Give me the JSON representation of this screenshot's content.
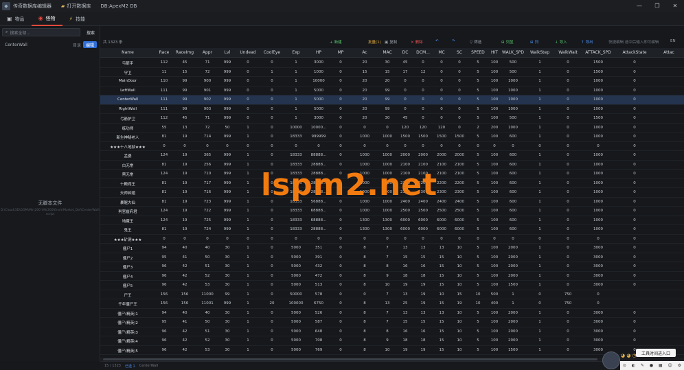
{
  "titlebar": {
    "app": "传奇数据库编辑器",
    "open_db": "打开数据库",
    "db_name": "DB:ApexM2 DB",
    "buttons": [
      "—",
      "❐",
      "✕"
    ]
  },
  "tabs": [
    {
      "icon": "▣",
      "label": "物品"
    },
    {
      "icon": "◉",
      "label": "怪物"
    },
    {
      "icon": "⚡",
      "label": "技能"
    }
  ],
  "sidebar": {
    "search_placeholder": "搜索全部...",
    "search_btn": "搜索",
    "item": "CenterWall",
    "item_extra": "目录",
    "item_btn": "编辑",
    "empty_title": "无脚本文件",
    "empty_sub": "D:\\Cloud\\3D\\GOM\\Mir\\200 \\Mir200\\Envir\\Market_Def\\CenterWall\\ script"
  },
  "toolbar": {
    "count": "共 1323 条",
    "actions": [
      {
        "icon": "+",
        "label": "新建",
        "color": "#57c26a"
      },
      {
        "icon": "",
        "label": "批量(1)",
        "color": "#e0a83a"
      },
      {
        "icon": "▣",
        "label": "复制",
        "color": "#9aa0a8"
      },
      {
        "icon": "✕",
        "label": "删除",
        "color": "#e05050"
      },
      {
        "icon": "↶",
        "label": "",
        "color": "#4c8ef0"
      },
      {
        "icon": "↷",
        "label": "",
        "color": "#4c8ef0"
      },
      {
        "icon": "▽",
        "label": "筛选",
        "color": "#9aa0a8"
      },
      {
        "icon": "⊞",
        "label": "列显",
        "color": "#57c26a"
      },
      {
        "icon": "⊞",
        "label": "列",
        "color": "#4c8ef0"
      },
      {
        "icon": "↓",
        "label": "导入",
        "color": "#57c26a"
      },
      {
        "icon": "↑",
        "label": "导出",
        "color": "#4c8ef0"
      },
      {
        "icon": "",
        "label": "快捷编辑   选中后输入即可编辑",
        "color": "#6f757d"
      },
      {
        "icon": "",
        "label": "EN",
        "color": "#9aa0a8"
      }
    ]
  },
  "columns": [
    "Name",
    "Race",
    "RaceImg",
    "Appr",
    "Lvl",
    "Undead",
    "CoolEye",
    "Exp",
    "HP",
    "MP",
    "Ac",
    "MAC",
    "DC",
    "DCM...",
    "MC",
    "SC",
    "SPEED",
    "HIT",
    "WALK_SPD",
    "WalkStep",
    "WalkWait",
    "ATTACK_SPD",
    "AttackState",
    "Attac"
  ],
  "rows": [
    [
      "弓箭手",
      "112",
      "45",
      "71",
      "999",
      "0",
      "0",
      "1",
      "3000",
      "0",
      "20",
      "30",
      "45",
      "0",
      "0",
      "0",
      "5",
      "100",
      "500",
      "1",
      "0",
      "1500",
      "0"
    ],
    [
      "守卫",
      "11",
      "15",
      "72",
      "999",
      "0",
      "1",
      "1",
      "1000",
      "0",
      "15",
      "15",
      "17",
      "12",
      "0",
      "0",
      "5",
      "100",
      "500",
      "1",
      "0",
      "1500",
      "0"
    ],
    [
      "MainDoor",
      "110",
      "99",
      "900",
      "999",
      "0",
      "0",
      "1",
      "10000",
      "0",
      "20",
      "20",
      "0",
      "0",
      "0",
      "0",
      "5",
      "100",
      "1000",
      "1",
      "0",
      "1000",
      "0"
    ],
    [
      "LeftWall",
      "111",
      "99",
      "901",
      "999",
      "0",
      "0",
      "1",
      "5000",
      "0",
      "20",
      "99",
      "0",
      "0",
      "0",
      "0",
      "5",
      "100",
      "1000",
      "1",
      "0",
      "1000",
      "0"
    ],
    [
      "CenterWall",
      "111",
      "99",
      "902",
      "999",
      "0",
      "0",
      "1",
      "5000",
      "0",
      "20",
      "99",
      "0",
      "0",
      "0",
      "0",
      "5",
      "100",
      "1000",
      "1",
      "0",
      "1000",
      "0"
    ],
    [
      "RightWall",
      "111",
      "99",
      "903",
      "999",
      "0",
      "0",
      "1",
      "5000",
      "0",
      "20",
      "99",
      "0",
      "0",
      "0",
      "0",
      "5",
      "100",
      "1000",
      "1",
      "0",
      "1000",
      "0"
    ],
    [
      "弓箭护卫",
      "112",
      "45",
      "71",
      "999",
      "0",
      "0",
      "1",
      "3000",
      "0",
      "20",
      "30",
      "45",
      "0",
      "0",
      "0",
      "5",
      "100",
      "500",
      "1",
      "0",
      "1500",
      "0"
    ],
    [
      "练功师",
      "55",
      "13",
      "72",
      "50",
      "1",
      "0",
      "10000",
      "10000...",
      "0",
      "0",
      "0",
      "120",
      "120",
      "120",
      "0",
      "2",
      "200",
      "1000",
      "1",
      "0",
      "1000",
      "0"
    ],
    [
      "新生神秘老人",
      "81",
      "19",
      "714",
      "999",
      "1",
      "0",
      "18333",
      "999999",
      "0",
      "1000",
      "1000",
      "1500",
      "1500",
      "1500",
      "1500",
      "5",
      "100",
      "600",
      "1",
      "0",
      "1000",
      "0"
    ],
    [
      "★★★十八地狱★★★",
      "0",
      "0",
      "0",
      "0",
      "0",
      "0",
      "0",
      "0",
      "0",
      "0",
      "0",
      "0",
      "0",
      "0",
      "0",
      "0",
      "0",
      "0",
      "0",
      "0",
      "0",
      "0"
    ],
    [
      "孟婆",
      "124",
      "19",
      "365",
      "999",
      "1",
      "0",
      "18333",
      "88888...",
      "0",
      "1000",
      "1000",
      "2000",
      "2000",
      "2000",
      "2000",
      "5",
      "100",
      "600",
      "1",
      "0",
      "1000",
      "0"
    ],
    [
      "白无常",
      "81",
      "19",
      "256",
      "999",
      "1",
      "0",
      "18333",
      "28888...",
      "0",
      "1000",
      "1000",
      "2100",
      "2100",
      "2100",
      "2100",
      "5",
      "100",
      "600",
      "1",
      "0",
      "1000",
      "0"
    ],
    [
      "黑无常",
      "124",
      "19",
      "710",
      "999",
      "1",
      "0",
      "18333",
      "28888...",
      "0",
      "1000",
      "1000",
      "2100",
      "2100",
      "2100",
      "2100",
      "5",
      "100",
      "600",
      "1",
      "0",
      "1000",
      "0"
    ],
    [
      "十殿阎王",
      "81",
      "19",
      "717",
      "999",
      "1",
      "0",
      "18333",
      "28888...",
      "0",
      "1000",
      "1000",
      "2200",
      "2200",
      "2200",
      "2200",
      "5",
      "100",
      "600",
      "1",
      "0",
      "1000",
      "0"
    ],
    [
      "天师钟馗",
      "81",
      "19",
      "716",
      "999",
      "1",
      "0",
      "18333",
      "28888...",
      "0",
      "1000",
      "1000",
      "2300",
      "2300",
      "2300",
      "2300",
      "5",
      "100",
      "600",
      "1",
      "0",
      "1000",
      "0"
    ],
    [
      "暴躯大仙",
      "81",
      "19",
      "723",
      "999",
      "1",
      "0",
      "18333",
      "56888...",
      "0",
      "1000",
      "1000",
      "2400",
      "2400",
      "2400",
      "2400",
      "5",
      "100",
      "600",
      "1",
      "0",
      "1000",
      "0"
    ],
    [
      "判官崔府君",
      "124",
      "19",
      "722",
      "999",
      "1",
      "0",
      "18333",
      "68888...",
      "0",
      "1000",
      "1000",
      "2500",
      "2500",
      "2500",
      "2500",
      "5",
      "100",
      "600",
      "1",
      "0",
      "1000",
      "0"
    ],
    [
      "地藏王",
      "124",
      "19",
      "725",
      "999",
      "1",
      "0",
      "18333",
      "68888...",
      "0",
      "1300",
      "1300",
      "6000",
      "6000",
      "6000",
      "6000",
      "5",
      "100",
      "600",
      "1",
      "0",
      "1000",
      "0"
    ],
    [
      "鬼王",
      "81",
      "19",
      "724",
      "999",
      "1",
      "0",
      "18333",
      "28888...",
      "0",
      "1300",
      "1300",
      "6000",
      "6000",
      "6000",
      "6000",
      "5",
      "100",
      "600",
      "1",
      "0",
      "1000",
      "0"
    ],
    [
      "★★★矿洞★★★",
      "0",
      "0",
      "0",
      "0",
      "0",
      "0",
      "0",
      "0",
      "0",
      "0",
      "0",
      "0",
      "0",
      "0",
      "0",
      "0",
      "0",
      "0",
      "0",
      "0",
      "0",
      "0"
    ],
    [
      "僵尸1",
      "94",
      "40",
      "40",
      "30",
      "1",
      "0",
      "5000",
      "351",
      "0",
      "8",
      "7",
      "13",
      "13",
      "13",
      "10",
      "5",
      "100",
      "2000",
      "1",
      "0",
      "3000",
      "0"
    ],
    [
      "僵尸2",
      "95",
      "41",
      "50",
      "30",
      "1",
      "0",
      "5000",
      "391",
      "0",
      "8",
      "7",
      "15",
      "15",
      "15",
      "10",
      "5",
      "100",
      "2000",
      "1",
      "0",
      "3000",
      "0"
    ],
    [
      "僵尸3",
      "96",
      "42",
      "51",
      "30",
      "1",
      "0",
      "5000",
      "432",
      "0",
      "8",
      "8",
      "16",
      "16",
      "15",
      "10",
      "5",
      "100",
      "2000",
      "1",
      "0",
      "3000",
      "0"
    ],
    [
      "僵尸4",
      "96",
      "42",
      "52",
      "30",
      "1",
      "0",
      "5000",
      "472",
      "0",
      "8",
      "9",
      "18",
      "18",
      "15",
      "10",
      "5",
      "100",
      "2000",
      "1",
      "0",
      "3000",
      "0"
    ],
    [
      "僵尸5",
      "96",
      "42",
      "53",
      "30",
      "1",
      "0",
      "5000",
      "513",
      "0",
      "8",
      "10",
      "19",
      "19",
      "15",
      "10",
      "5",
      "100",
      "1500",
      "1",
      "0",
      "3000",
      "0"
    ],
    [
      "尸王",
      "156",
      "156",
      "11000",
      "99",
      "1",
      "0",
      "50000",
      "578",
      "0",
      "0",
      "7",
      "13",
      "19",
      "10",
      "15",
      "10",
      "500",
      "1",
      "0",
      "750",
      "0"
    ],
    [
      "千年僵尸王",
      "156",
      "156",
      "11001",
      "999",
      "1",
      "20",
      "100000",
      "6750",
      "0",
      "8",
      "13",
      "25",
      "19",
      "15",
      "19",
      "10",
      "400",
      "1",
      "0",
      "750",
      "0"
    ],
    [
      "僵尸(精英)1",
      "94",
      "40",
      "40",
      "30",
      "1",
      "0",
      "5000",
      "526",
      "0",
      "8",
      "7",
      "13",
      "13",
      "13",
      "10",
      "5",
      "100",
      "2000",
      "1",
      "0",
      "3000",
      "0"
    ],
    [
      "僵尸(精英)2",
      "95",
      "41",
      "50",
      "30",
      "1",
      "0",
      "5000",
      "587",
      "0",
      "8",
      "7",
      "15",
      "15",
      "15",
      "10",
      "5",
      "100",
      "2000",
      "1",
      "0",
      "3000",
      "0"
    ],
    [
      "僵尸(精英)3",
      "96",
      "42",
      "51",
      "30",
      "1",
      "0",
      "5000",
      "648",
      "0",
      "8",
      "8",
      "16",
      "16",
      "15",
      "10",
      "5",
      "100",
      "2000",
      "1",
      "0",
      "3000",
      "0"
    ],
    [
      "僵尸(精英)4",
      "96",
      "42",
      "52",
      "30",
      "1",
      "0",
      "5000",
      "708",
      "0",
      "8",
      "9",
      "18",
      "18",
      "15",
      "10",
      "5",
      "100",
      "2000",
      "1",
      "0",
      "3000",
      "0"
    ],
    [
      "僵尸(精英)5",
      "96",
      "42",
      "53",
      "30",
      "1",
      "0",
      "5000",
      "769",
      "0",
      "8",
      "10",
      "19",
      "19",
      "15",
      "10",
      "5",
      "100",
      "1500",
      "1",
      "0",
      "3000",
      "0"
    ]
  ],
  "selected_row": 4,
  "status": {
    "left": "15 / 1323",
    "mid": "已选 1",
    "right": "CenterWall"
  },
  "watermark": "lspm2.net",
  "overlay": {
    "chat": "工具时间进入口",
    "stickers": "◕ ◕ ◔"
  }
}
